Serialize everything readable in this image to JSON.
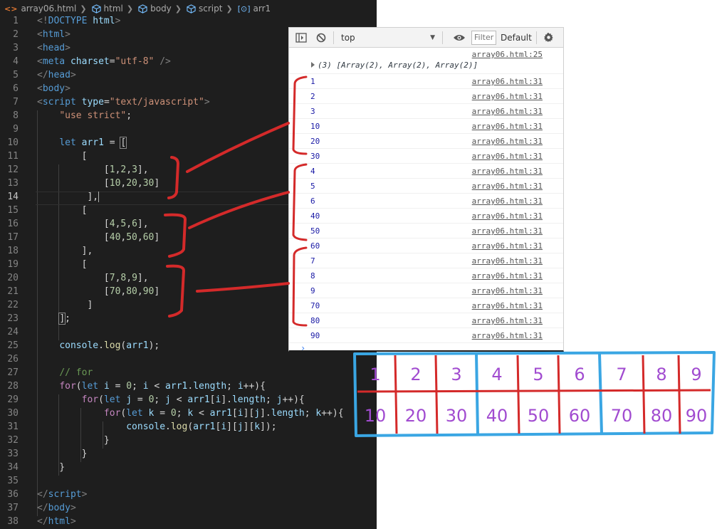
{
  "breadcrumb": {
    "file": "array06.html",
    "items": [
      "html",
      "body",
      "script"
    ],
    "symbol": "arr1"
  },
  "code": {
    "lines": [
      "1",
      "2",
      "3",
      "4",
      "5",
      "6",
      "7",
      "8",
      "9",
      "10",
      "11",
      "12",
      "13",
      "14",
      "15",
      "16",
      "17",
      "18",
      "19",
      "20",
      "21",
      "22",
      "23",
      "24",
      "25",
      "26",
      "27",
      "28",
      "29",
      "30",
      "31",
      "32",
      "33",
      "34",
      "35",
      "36",
      "37",
      "38"
    ],
    "current_line": "14"
  },
  "console": {
    "context": "top",
    "filter_placeholder": "Filter",
    "levels": "Default",
    "array_log": {
      "source": "array06.html:25",
      "summary": "(3) [Array(2), Array(2), Array(2)]"
    },
    "logs": [
      {
        "value": "1",
        "source": "array06.html:31"
      },
      {
        "value": "2",
        "source": "array06.html:31"
      },
      {
        "value": "3",
        "source": "array06.html:31"
      },
      {
        "value": "10",
        "source": "array06.html:31"
      },
      {
        "value": "20",
        "source": "array06.html:31"
      },
      {
        "value": "30",
        "source": "array06.html:31"
      },
      {
        "value": "4",
        "source": "array06.html:31"
      },
      {
        "value": "5",
        "source": "array06.html:31"
      },
      {
        "value": "6",
        "source": "array06.html:31"
      },
      {
        "value": "40",
        "source": "array06.html:31"
      },
      {
        "value": "50",
        "source": "array06.html:31"
      },
      {
        "value": "60",
        "source": "array06.html:31"
      },
      {
        "value": "7",
        "source": "array06.html:31"
      },
      {
        "value": "8",
        "source": "array06.html:31"
      },
      {
        "value": "9",
        "source": "array06.html:31"
      },
      {
        "value": "70",
        "source": "array06.html:31"
      },
      {
        "value": "80",
        "source": "array06.html:31"
      },
      {
        "value": "90",
        "source": "array06.html:31"
      }
    ],
    "prompt": "›"
  },
  "sketch": {
    "top_row": [
      "1",
      "2",
      "3",
      "4",
      "5",
      "6",
      "7",
      "8",
      "9"
    ],
    "bottom_row": [
      "10",
      "20",
      "30",
      "40",
      "50",
      "60",
      "70",
      "80",
      "90"
    ]
  },
  "colors": {
    "annotation_red": "#d42a2a",
    "sketch_blue": "#3aa6e3",
    "sketch_purple": "#a14bd0"
  }
}
